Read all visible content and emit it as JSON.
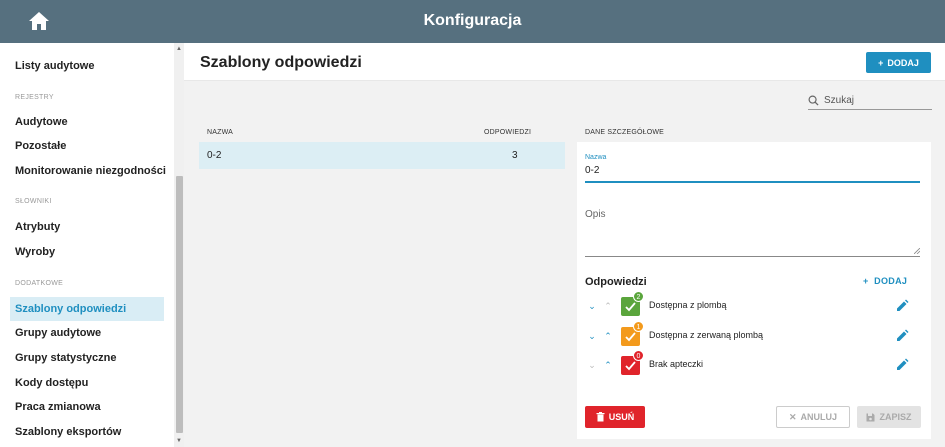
{
  "app": {
    "title": "Konfiguracja"
  },
  "sidebar": {
    "top_items": [
      {
        "label": "Listy audytowe"
      }
    ],
    "sections": [
      {
        "title": "REJESTRY",
        "items": [
          {
            "label": "Audytowe"
          },
          {
            "label": "Pozostałe"
          },
          {
            "label": "Monitorowanie niezgodności"
          }
        ]
      },
      {
        "title": "SŁOWNIKI",
        "items": [
          {
            "label": "Atrybuty"
          },
          {
            "label": "Wyroby"
          }
        ]
      },
      {
        "title": "DODATKOWE",
        "items": [
          {
            "label": "Szablony odpowiedzi"
          },
          {
            "label": "Grupy audytowe"
          },
          {
            "label": "Grupy statystyczne"
          },
          {
            "label": "Kody dostępu"
          },
          {
            "label": "Praca zmianowa"
          },
          {
            "label": "Szablony eksportów"
          }
        ]
      }
    ],
    "active_item": "Szablony odpowiedzi"
  },
  "page": {
    "title": "Szablony odpowiedzi",
    "add_label": "DODAJ"
  },
  "search": {
    "placeholder": "Szukaj"
  },
  "table": {
    "columns": [
      "NAZWA",
      "ODPOWIEDZI"
    ],
    "rows": [
      {
        "name": "0-2",
        "answers": "3"
      }
    ]
  },
  "details": {
    "header": "DANE SZCZEGÓŁOWE",
    "name_label": "Nazwa",
    "name_value": "0-2",
    "description_label": "Opis",
    "answers_title": "Odpowiedzi",
    "answers_add_label": "DODAJ",
    "answers": [
      {
        "label": "Dostępna z plombą",
        "count": "2",
        "color": "#5aa53c",
        "badge_color": "#5aa53c"
      },
      {
        "label": "Dostępna z zerwaną plombą",
        "count": "1",
        "color": "#f39a1c",
        "badge_color": "#f39a1c"
      },
      {
        "label": "Brak apteczki",
        "count": "0",
        "color": "#e0242b",
        "badge_color": "#e0242b"
      }
    ],
    "delete_label": "USUŃ",
    "cancel_label": "ANULUJ",
    "save_label": "ZAPISZ"
  },
  "colors": {
    "accent": "#1f8fc0",
    "header_bg": "#56707f",
    "danger": "#e0242b",
    "selected_row": "#dceef4"
  }
}
